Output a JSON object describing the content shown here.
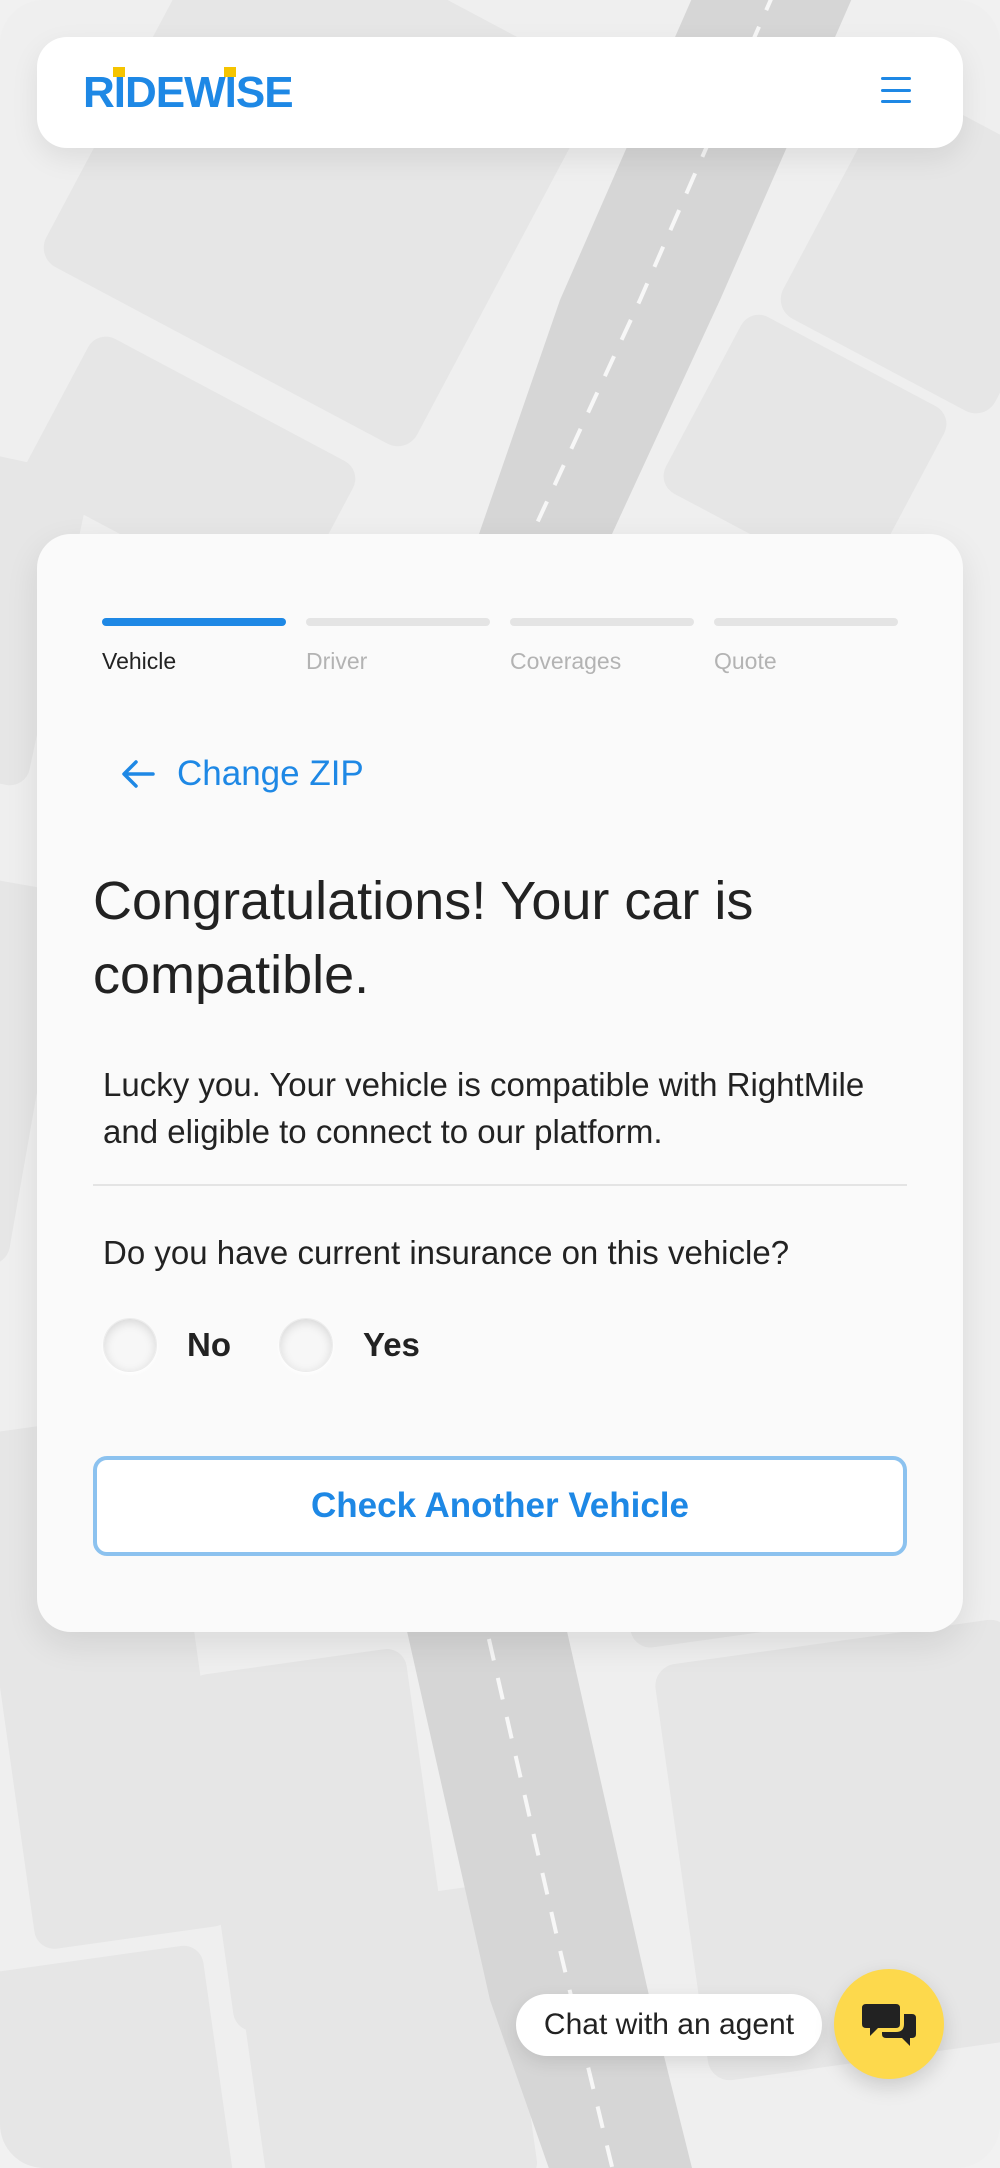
{
  "header": {
    "logo_text": "RIDEWISE",
    "menu_icon": "hamburger-menu-icon",
    "brand_color": "#1e88e5",
    "logo_dot_color": "#f5c400"
  },
  "progress": {
    "steps": [
      {
        "label": "Vehicle",
        "active": true
      },
      {
        "label": "Driver",
        "active": false
      },
      {
        "label": "Coverages",
        "active": false
      },
      {
        "label": "Quote",
        "active": false
      }
    ]
  },
  "back_link": {
    "label": "Change ZIP",
    "icon": "arrow-left-icon"
  },
  "main": {
    "title": "Congratulations! Your car is compatible.",
    "description": "Lucky you. Your vehicle is compatible with RightMile and eligible to connect to our platform.",
    "question": "Do you have current insurance on this vehicle?",
    "options": [
      "No",
      "Yes"
    ],
    "check_button_label": "Check Another Vehicle"
  },
  "chat": {
    "label": "Chat with an agent",
    "icon": "chat-bubbles-icon",
    "button_color": "#fdd94c"
  }
}
